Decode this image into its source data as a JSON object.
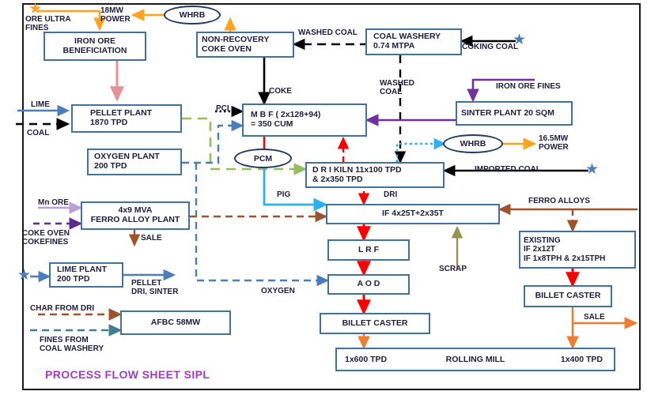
{
  "diagram": {
    "title": "PROCESS FLOW SHEET SIPL",
    "colors": {
      "box_border": "#41719C",
      "text": "#1d1d3a",
      "title": "#9C3FBF",
      "frame": "#1a1a1a",
      "orange": "#FFA21E",
      "pink": "#E79098",
      "blue": "#4A7EBB",
      "black": "#000000",
      "purple": "#7030A0",
      "green": "#94BE58",
      "red": "#FF0000",
      "cyan": "#2CB0EF",
      "brown": "#A0522D",
      "olive": "#9A9250",
      "sale_orange": "#ED7D31",
      "lilac": "#B9A0D8",
      "darkviolet": "#5B2C8D",
      "teal": "#3F7E8E"
    }
  },
  "boxes": {
    "iron_ore_beneficiation": {
      "lines": [
        "IRON ORE",
        "BENEFICIATION"
      ]
    },
    "non_recovery_coke_oven": {
      "lines": [
        "NON-RECOVERY",
        "COKE OVEN"
      ]
    },
    "coal_washery": {
      "lines": [
        "COAL WASHERY",
        "0.74 MTPA"
      ]
    },
    "pellet_plant": {
      "lines": [
        "PELLET PLANT",
        "1870 TPD"
      ]
    },
    "mbf": {
      "lines": [
        "M B F ( 2x128+94)",
        "= 350 CUM"
      ]
    },
    "sinter_plant": {
      "lines": [
        "SINTER PLANT 20 SQM"
      ]
    },
    "oxygen_plant": {
      "lines": [
        "OXYGEN PLANT",
        "200 TPD"
      ]
    },
    "dri_kiln": {
      "lines": [
        "D R I KILN 11x100 TPD",
        "& 2x350 TPD"
      ]
    },
    "ferro_alloy_plant": {
      "lines": [
        "4x9 MVA",
        "FERRO ALLOY PLANT"
      ]
    },
    "induction_furnace": {
      "lines": [
        "IF  4x25T+2x35T"
      ]
    },
    "existing_if": {
      "lines": [
        "EXISTING",
        "IF 2x12T",
        "IF 1x8TPH & 2x15TPH"
      ]
    },
    "lime_plant": {
      "lines": [
        "LIME  PLANT",
        "200 TPD"
      ]
    },
    "lrf": {
      "lines": [
        "L R F"
      ]
    },
    "aod": {
      "lines": [
        "A O D"
      ]
    },
    "afbc": {
      "lines": [
        "AFBC   58MW"
      ]
    },
    "billet_caster_left": {
      "lines": [
        "BILLET CASTER"
      ]
    },
    "billet_caster_right": {
      "lines": [
        "BILLET CASTER"
      ]
    },
    "rolling_mill": {
      "left": "1x600 TPD",
      "center": "ROLLING MILL",
      "right": "1x400 TPD"
    }
  },
  "ellipses": {
    "whrb_top": "WHRB",
    "whrb_right": "WHRB",
    "pcm": "PCM"
  },
  "labels": {
    "ore_ultra_fines": [
      "ORE ULTRA",
      "FINES"
    ],
    "power_18mw": [
      "18MW",
      "POWER"
    ],
    "washed_coal_top": "WASHED COAL",
    "coking_coal": "COKING COAL",
    "washed_coal_down": [
      "WASHED",
      "COAL"
    ],
    "coke": "COKE",
    "iron_ore_fines": "IRON ORE FINES",
    "lime": "LIME",
    "coal": "COAL",
    "pci": "PCI",
    "power_165mw": [
      "16.5MW",
      "POWER"
    ],
    "imported_coal": "IMPORTED  COAL",
    "pig": "PIG",
    "dri": "DRI",
    "mn_ore": "Mn ORE",
    "coke_oven_cokefines": [
      "COKE OVEN",
      "COKEFINES"
    ],
    "sale_ferro": "SALE",
    "ferro_alloys": "FERRO ALLOYS",
    "scrap": "SCRAP",
    "pellet_dri_sinter": [
      "PELLET",
      "DRI, SINTER"
    ],
    "oxygen": "OXYGEN",
    "char_from_dri": "CHAR FROM DRI",
    "fines_from_coal_washery": [
      "FINES FROM",
      " COAL WASHERY"
    ],
    "sale_billet": "SALE"
  }
}
